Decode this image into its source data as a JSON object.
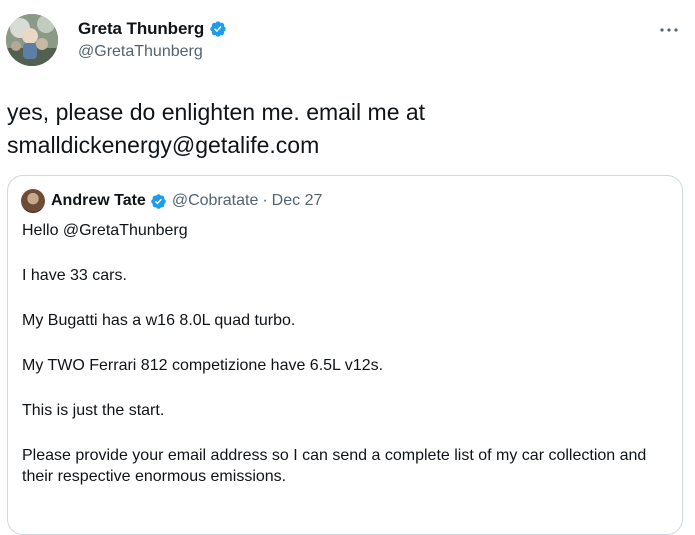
{
  "tweet": {
    "author": {
      "display_name": "Greta Thunberg",
      "handle": "@GretaThunberg",
      "verified": true
    },
    "text_lines": [
      "yes, please do enlighten me. email me at",
      "smalldickenergy@getalife.com"
    ],
    "more_icon": "more-horizontal-icon"
  },
  "quoted_tweet": {
    "author": {
      "display_name": "Andrew Tate",
      "handle": "@Cobratate",
      "separator": "·",
      "date": "Dec 27",
      "verified": true
    },
    "paragraphs": [
      "Hello @GretaThunberg",
      "I have 33 cars.",
      "My Bugatti has a w16 8.0L quad turbo.",
      "My TWO Ferrari 812 competizione have 6.5L v12s.",
      "This is just the start.",
      "Please provide your email address so I can send a complete list of my car collection and their respective enormous emissions."
    ]
  },
  "colors": {
    "primary_text": "#0f1419",
    "secondary_text": "#536471",
    "verified_blue": "#1d9bf0",
    "border": "#cfd9de"
  }
}
